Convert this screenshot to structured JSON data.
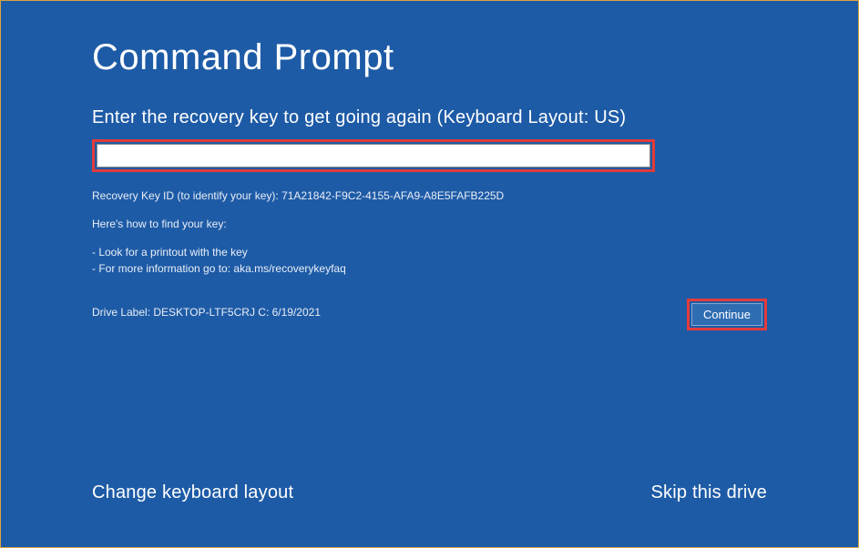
{
  "title": "Command Prompt",
  "prompt_label": "Enter the recovery key to get going again (Keyboard Layout: US)",
  "recovery_input_value": "",
  "recovery_key_id_line": "Recovery Key ID (to identify your key): 71A21842-F9C2-4155-AFA9-A8E5FAFB225D",
  "how_to_find_label": "Here's how to find your key:",
  "tip_1": "- Look for a printout with the key",
  "tip_2": "- For more information go to: aka.ms/recoverykeyfaq",
  "drive_label": "Drive Label: DESKTOP-LTF5CRJ C: 6/19/2021",
  "continue_button": "Continue",
  "footer": {
    "change_layout": "Change keyboard layout",
    "skip_drive": "Skip this drive"
  }
}
